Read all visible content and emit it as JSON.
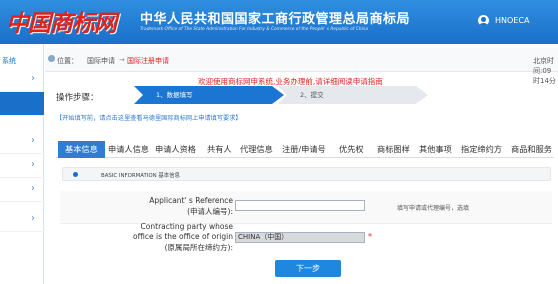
{
  "header": {
    "logo_text": "中国商标网",
    "title": "中华人民共和国国家工商行政管理总局商标局",
    "subtitle": "Trademark Office of The State Administration For Industry & Commerce of the People' s Republic of China",
    "username": "HNOECA"
  },
  "sidebar": {
    "label": "系统",
    "items": [
      {
        "chevron": "›"
      },
      {
        "chevron": "›"
      },
      {
        "chevron": "›"
      },
      {
        "chevron": "›"
      },
      {
        "chevron": "›"
      },
      {
        "chevron": "›"
      }
    ]
  },
  "breadcrumb": {
    "prefix": "位置：",
    "item1": "国际申请",
    "separator": "→",
    "item2": "国际注册申请",
    "clock": "北京时间:09时14分"
  },
  "welcome": "欢迎使用商标网申系统,业务办理前,请详细阅读申请指南",
  "steps": {
    "label": "操作步骤：",
    "step1": "1、数据填写",
    "step2": "2、提交"
  },
  "note": "【开始填写前，请点击这里查看马德里国际商标网上申请填写要求】",
  "tabs": [
    "基本信息",
    "申请人信息",
    "申请人资格",
    "共有人",
    "代理信息",
    "注册/申请号",
    "优先权",
    "商标图样",
    "其他事项",
    "指定缔约方",
    "商品和服务"
  ],
  "section_title": "BASIC INFORMATION 基本信息",
  "form": {
    "ref_label_en": "Applicant' s Reference",
    "ref_label_cn": "(申请人编号):",
    "ref_value": "",
    "ref_hint": "填写申请或代理编号，选填",
    "origin_label_en1": "Contracting party whose",
    "origin_label_en2": "office is the office of origin",
    "origin_label_cn": "(原属局所在缔约方):",
    "origin_value": "CHINA（中国）",
    "required_mark": "*"
  },
  "next_button": "下一步",
  "colors": {
    "primary": "#1a6fc9",
    "accent_red": "#e0221a",
    "tab_active": "#2f7dd3"
  }
}
